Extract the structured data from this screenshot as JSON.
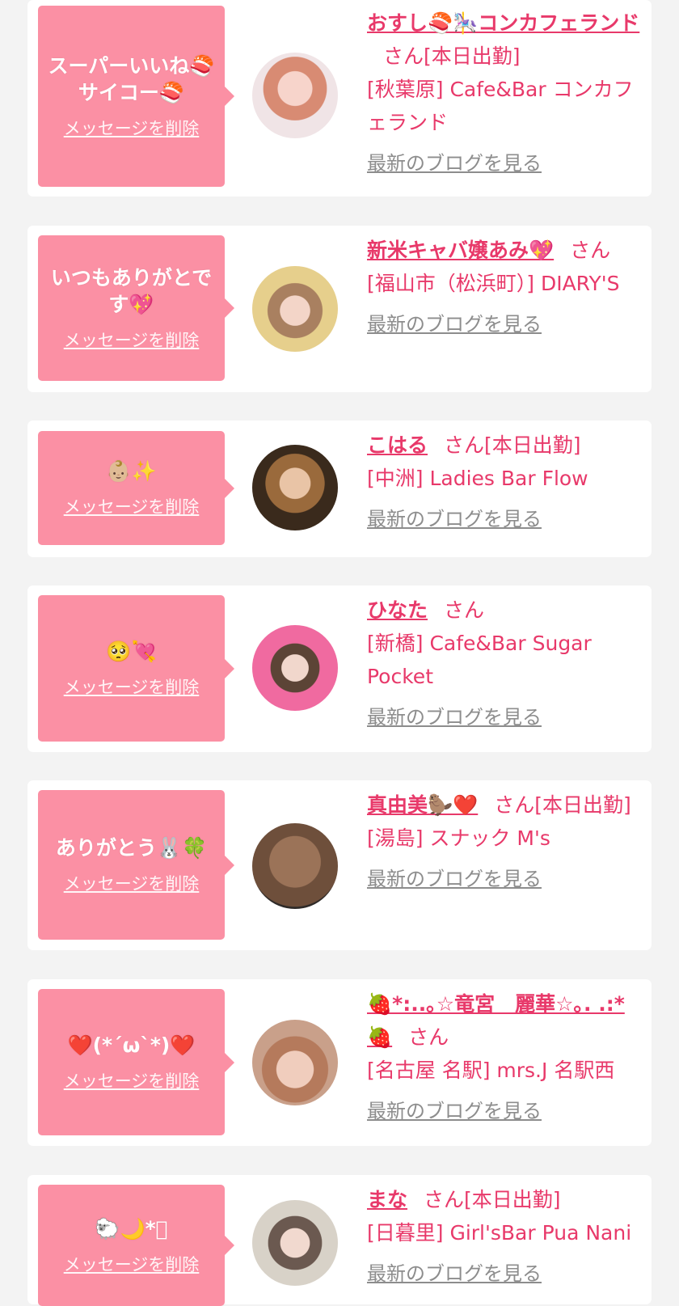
{
  "entries": [
    {
      "message": "スーパーいいね🍣サイコー🍣",
      "delete_label": "メッセージを削除",
      "name": "おすし🍣🎠コンカフェランド",
      "honorific": "さん",
      "status": "[本日出勤]",
      "shop": "[秋葉原] Cafe&Bar コンカフェランド",
      "blog_label": "最新のブログを見る",
      "avatar_icon": "profile-photo"
    },
    {
      "message": "いつもありがとです💖",
      "delete_label": "メッセージを削除",
      "name": "新米キャバ嬢あみ💖",
      "honorific": "さん",
      "status": "",
      "shop": "[福山市（松浜町）] DIARY'S",
      "blog_label": "最新のブログを見る",
      "avatar_icon": "profile-photo"
    },
    {
      "message": "👶🏼✨",
      "delete_label": "メッセージを削除",
      "name": "こはる",
      "honorific": "さん",
      "status": "[本日出勤]",
      "shop": "[中洲] Ladies Bar Flow",
      "blog_label": "最新のブログを見る",
      "avatar_icon": "profile-photo"
    },
    {
      "message": "🥺💘",
      "delete_label": "メッセージを削除",
      "name": "ひなた",
      "honorific": "さん",
      "status": "",
      "shop": "[新橋] Cafe&Bar Sugar Pocket",
      "blog_label": "最新のブログを見る",
      "avatar_icon": "profile-photo"
    },
    {
      "message": "ありがとう🐰🍀",
      "delete_label": "メッセージを削除",
      "name": "真由美🦫❤️",
      "honorific": "さん",
      "status": "[本日出勤]",
      "shop": "[湯島] スナック M's",
      "blog_label": "最新のブログを見る",
      "avatar_icon": "profile-photo"
    },
    {
      "message": "❤️(*´ω`*)❤️",
      "delete_label": "メッセージを削除",
      "name": "🍓*:..｡☆竜宮　麗華☆｡. .:*🍓",
      "honorific": "さん",
      "status": "",
      "shop": "[名古屋 名駅] mrs.J 名駅西",
      "blog_label": "最新のブログを見る",
      "avatar_icon": "profile-photo"
    },
    {
      "message": "🐑🌙*ﾟ",
      "delete_label": "メッセージを削除",
      "name": "まな",
      "honorific": "さん",
      "status": "[本日出勤]",
      "shop": "[日暮里] Girl'sBar Pua Nani",
      "blog_label": "最新のブログを見る",
      "avatar_icon": "profile-photo"
    }
  ],
  "colors": {
    "bubble": "#fb90a4",
    "accent": "#e8396a",
    "link_gray": "#8d8d8d",
    "background": "#f3f3f3"
  }
}
